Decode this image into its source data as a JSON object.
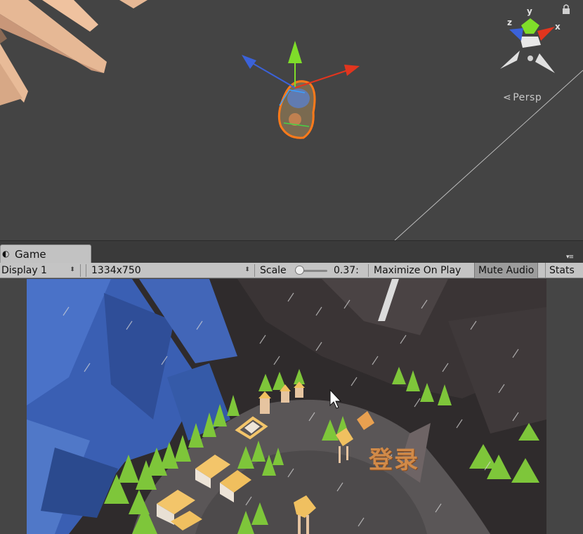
{
  "scene_view": {
    "camera_mode": "Persp",
    "gizmo_axes": {
      "x": "x",
      "y": "y",
      "z": "z"
    },
    "colors": {
      "x_axis": "#e2351e",
      "y_axis": "#7fdd2a",
      "z_axis": "#3b62d9",
      "background": "#444444"
    }
  },
  "game_tab": {
    "label": "Game",
    "icon": "pacman-game-icon"
  },
  "toolbar": {
    "display": "Display 1",
    "resolution": "1334x750",
    "scale_label": "Scale",
    "scale_value": "0.37:",
    "scale_level": 0.37,
    "maximize_on_play": "Maximize On Play",
    "mute_audio": "Mute Audio",
    "stats": "Stats"
  },
  "game_view": {
    "login_text": "登录",
    "colors": {
      "login": "#d08a49",
      "trees": "#7ec63a",
      "crystals": "#3a5fb3"
    }
  }
}
